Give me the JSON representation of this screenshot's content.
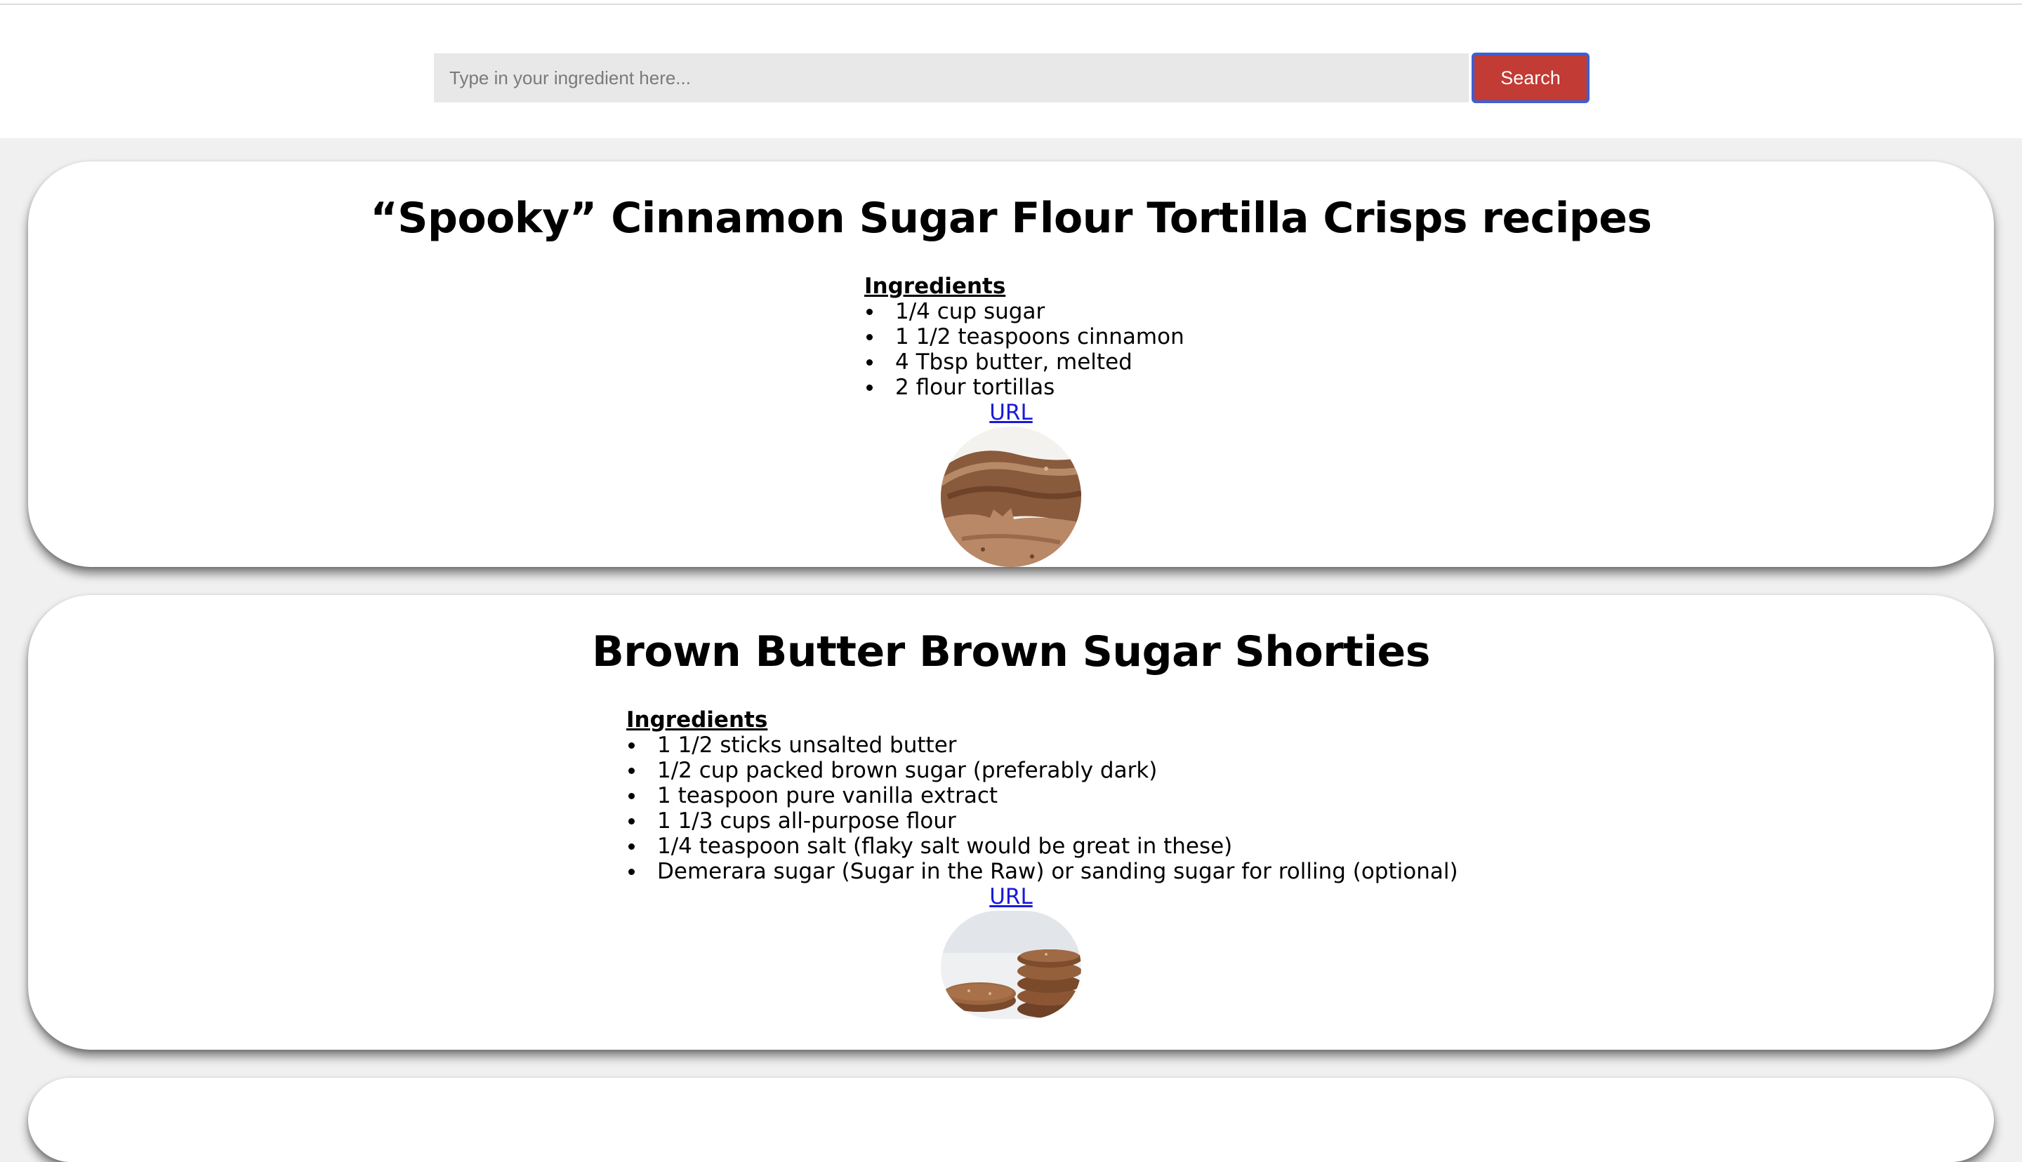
{
  "search": {
    "placeholder": "Type in your ingredient here...",
    "value": "",
    "button_label": "Search"
  },
  "recipes": [
    {
      "title": "“Spooky” Cinnamon Sugar Flour Tortilla Crisps recipes",
      "ingredients_heading": "Ingredients",
      "ingredients": [
        "1/4 cup sugar",
        "1 1/2 teaspoons cinnamon",
        "4 Tbsp butter, melted",
        "2 flour tortillas"
      ],
      "url_label": "URL",
      "image_icon": "tortilla-crisps-photo"
    },
    {
      "title": "Brown Butter Brown Sugar Shorties",
      "ingredients_heading": "Ingredients",
      "ingredients": [
        "1 1/2 sticks unsalted butter",
        "1/2 cup packed brown sugar (preferably dark)",
        "1 teaspoon pure vanilla extract",
        "1 1/3 cups all-purpose flour",
        "1/4 teaspoon salt (flaky salt would be great in these)",
        "Demerara sugar (Sugar in the Raw) or sanding sugar for rolling (optional)"
      ],
      "url_label": "URL",
      "image_icon": "shortbread-cookies-photo"
    }
  ],
  "colors": {
    "search_button": "#c23b34",
    "search_button_border": "#3b5fd4",
    "link": "#1a1ad8",
    "input_bg": "#e8e8e8"
  }
}
